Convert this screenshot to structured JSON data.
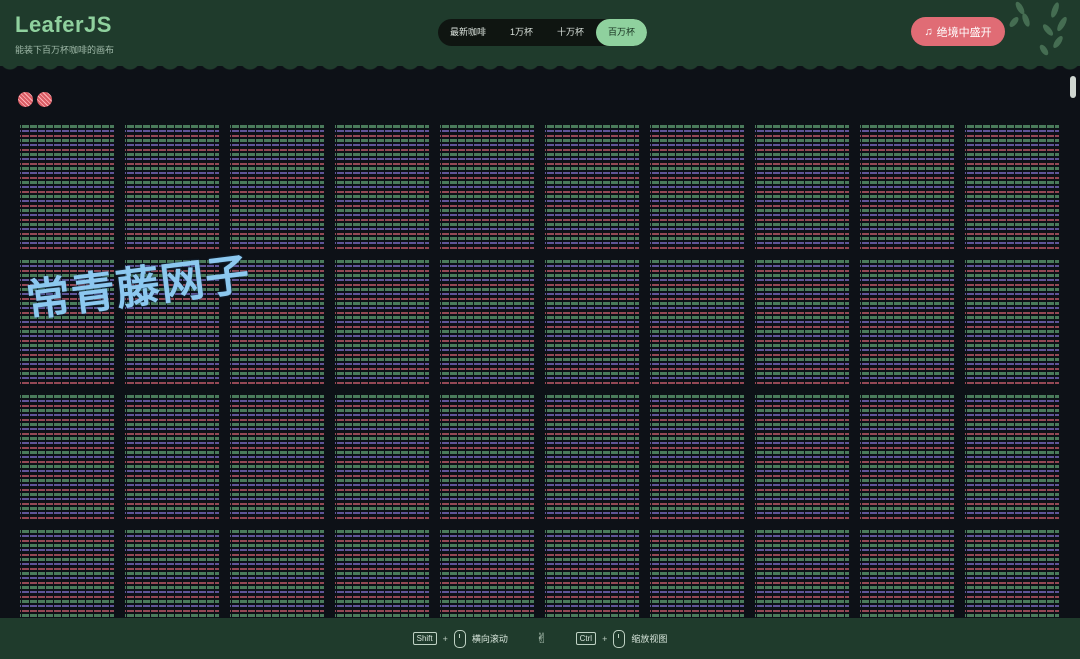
{
  "header": {
    "logo": "LeaferJS",
    "subtitle": "能装下百万杯咖啡的画布",
    "tabs": [
      {
        "label": "最新咖啡",
        "active": false
      },
      {
        "label": "1万杯",
        "active": false
      },
      {
        "label": "十万杯",
        "active": false
      },
      {
        "label": "百万杯",
        "active": true
      }
    ],
    "cta_icon": "♫",
    "cta_label": "绝境中盛开"
  },
  "canvas": {
    "watermark": "常青藤网子",
    "grid_columns": 10,
    "grid_rows": 4
  },
  "footer": {
    "shift_key": "Shift",
    "plus1": "+",
    "scroll_label": "横向滚动",
    "gesture_icon": "✌",
    "ctrl_key": "Ctrl",
    "plus2": "+",
    "zoom_label": "缩放视图"
  },
  "colors": {
    "header_bg": "#1f3b2c",
    "accent": "#8fd19e",
    "cta": "#e06c75",
    "canvas_bg": "#0d1117"
  }
}
